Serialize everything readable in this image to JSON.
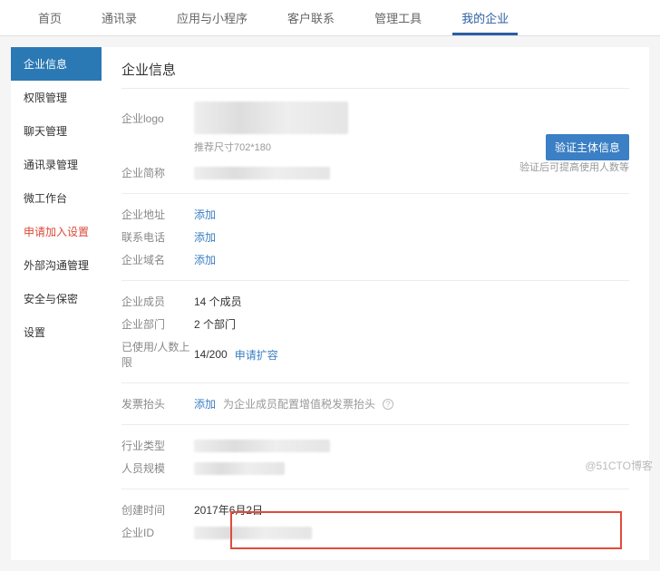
{
  "topnav": {
    "items": [
      "首页",
      "通讯录",
      "应用与小程序",
      "客户联系",
      "管理工具",
      "我的企业"
    ],
    "activeIndex": 5
  },
  "sidebar": {
    "items": [
      {
        "label": "企业信息",
        "active": true
      },
      {
        "label": "权限管理"
      },
      {
        "label": "聊天管理"
      },
      {
        "label": "通讯录管理"
      },
      {
        "label": "微工作台"
      },
      {
        "label": "申请加入设置",
        "highlight": true
      },
      {
        "label": "外部沟通管理"
      },
      {
        "label": "安全与保密"
      },
      {
        "label": "设置"
      }
    ]
  },
  "page": {
    "title": "企业信息",
    "logoLabel": "企业logo",
    "logoHint": "推荐尺寸702*180",
    "shortNameLabel": "企业简称",
    "verifyButton": "验证主体信息",
    "verifyHint": "验证后可提高使用人数等",
    "addressLabel": "企业地址",
    "addLink": "添加",
    "phoneLabel": "联系电话",
    "domainLabel": "企业域名",
    "membersLabel": "企业成员",
    "membersValue": "14 个成员",
    "deptLabel": "企业部门",
    "deptValue": "2 个部门",
    "usageLabel": "已使用/人数上限",
    "usageValue": "14/200",
    "expandLink": "申请扩容",
    "invoiceLabel": "发票抬头",
    "invoiceHint": "为企业成员配置增值税发票抬头",
    "industryLabel": "行业类型",
    "scaleLabel": "人员规模",
    "createdLabel": "创建时间",
    "createdValue": "2017年6月2日",
    "corpIdLabel": "企业ID"
  },
  "watermark": "@51CTO博客"
}
